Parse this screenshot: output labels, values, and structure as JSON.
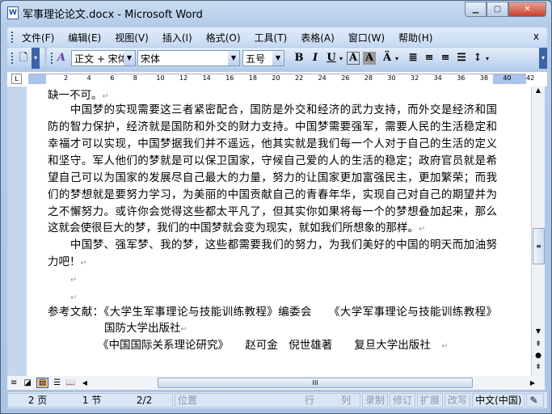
{
  "window": {
    "title": "军事理论论文.docx - Microsoft Word",
    "app_icon": "W"
  },
  "menu": [
    "文件(F)",
    "编辑(E)",
    "视图(V)",
    "插入(I)",
    "格式(O)",
    "工具(T)",
    "表格(A)",
    "窗口(W)",
    "帮助(H)"
  ],
  "menu_close": "x",
  "toolbar": {
    "style": "正文 + 宋体",
    "font": "宋体",
    "size": "五号",
    "bold": "B",
    "italic": "I",
    "underline": "U",
    "char_border": "A",
    "char_shade": "A"
  },
  "ruler": {
    "ticks": [
      "2",
      "4",
      "6",
      "8",
      "10",
      "12",
      "14",
      "16",
      "18",
      "20",
      "22",
      "24",
      "26",
      "28",
      "30",
      "32",
      "34",
      "36",
      "38",
      "40",
      "42"
    ]
  },
  "document": {
    "lines": [
      "缺一不可。",
      "　　中国梦的实现需要这三者紧密配合，国防是外交和经济的武力支持，而外交是经济和国",
      "防的智力保护，经济就是国防和外交的财力支持。中国梦需要强军，需要人民的生活稳定和",
      "幸福才可以实现，中国梦据我们并不遥远，他其实就是我们每一个人对于自己的生活的定义",
      "和坚守。军人他们的梦就是可以保卫国家，守候自己爱的人的生活的稳定；政府官员就是希",
      "望自己可以为国家的发展尽自己最大的力量，努力的让国家更加富强民主，更加繁荣；而我",
      "们的梦想就是要努力学习，为美丽的中国贡献自己的青春年华，实现自己对自己的期望并为",
      "之不懈努力。或许你会觉得这些都太平凡了，但其实你如果将每一个的梦想叠加起来，那么",
      "这就会使很巨大的梦，我们的中国梦就会变为现实，就如我们所想象的那样。",
      "　　中国梦、强军梦、我的梦，这些都需要我们的努力，为我们美好的中国的明天而加油努",
      "力吧！",
      "",
      "",
      "参考文献：《大学生军事理论与技能训练教程》编委会　　《大学军事理论与技能训练教程》",
      "国防大学出版社",
      "《中国国际关系理论研究》　　赵可金　倪世雄著　　复旦大学出版社　"
    ],
    "para_mark": "↵"
  },
  "status": {
    "page": "2 页",
    "section": "1 节",
    "pages": "2/2",
    "position": "位置",
    "line": "行",
    "column": "列",
    "rec": "录制",
    "trk": "修订",
    "ext": "扩展",
    "ovr": "改写",
    "language": "中文(中国)"
  }
}
